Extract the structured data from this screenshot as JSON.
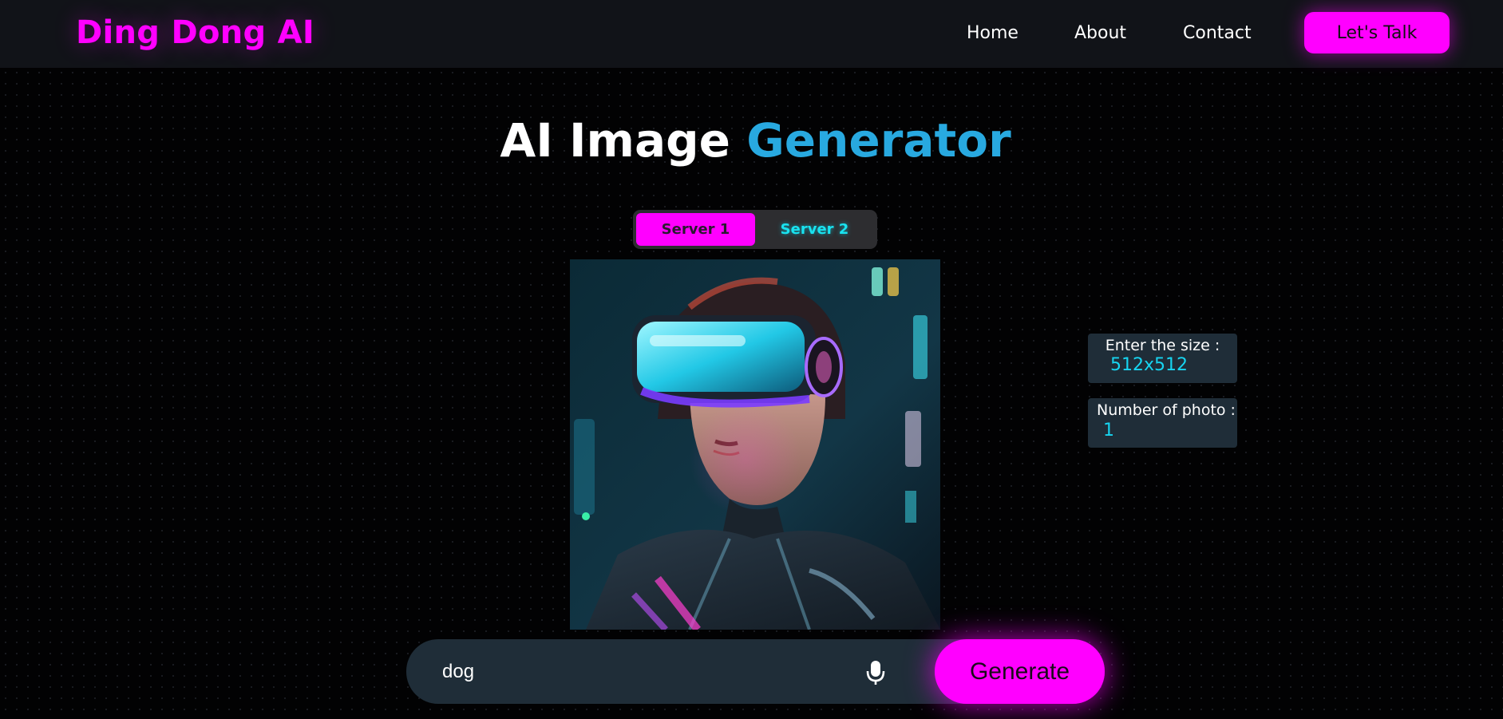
{
  "header": {
    "brand": "Ding Dong AI",
    "nav": [
      {
        "label": "Home"
      },
      {
        "label": "About"
      },
      {
        "label": "Contact"
      }
    ],
    "cta_label": "Let's Talk"
  },
  "hero": {
    "title_main": "AI Image ",
    "title_accent": "Generator"
  },
  "servers": {
    "options": [
      "Server 1",
      "Server 2"
    ],
    "selected": "Server 1"
  },
  "preview": {
    "alt": "Cyberpunk woman wearing VR headset"
  },
  "options": {
    "size_label": "Enter the size :",
    "size_value": "512x512",
    "count_label": "Number of photo :",
    "count_value": "1"
  },
  "prompt": {
    "value": "dog",
    "generate_label": "Generate"
  },
  "colors": {
    "accent": "#ff00ff",
    "cyan": "#17d4f0",
    "blue_title": "#28a9e0",
    "panel": "#1f2d38"
  }
}
